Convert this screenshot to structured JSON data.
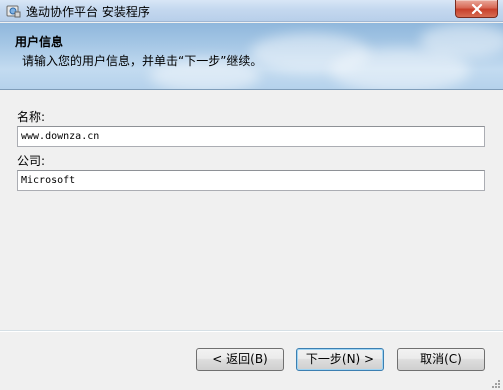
{
  "window": {
    "title": "逸动协作平台 安装程序"
  },
  "header": {
    "title": "用户信息",
    "subtitle": "请输入您的用户信息，并单击“下一步”继续。"
  },
  "form": {
    "name_label": "名称:",
    "name_value": "www.downza.cn",
    "company_label": "公司:",
    "company_value": "Microsoft"
  },
  "buttons": {
    "back": "< 返回(B)",
    "next": "下一步(N) >",
    "cancel": "取消(C)"
  },
  "colors": {
    "banner": "#a7c8e6",
    "close": "#c7402b",
    "default_button_border": "#3c7fb1"
  }
}
